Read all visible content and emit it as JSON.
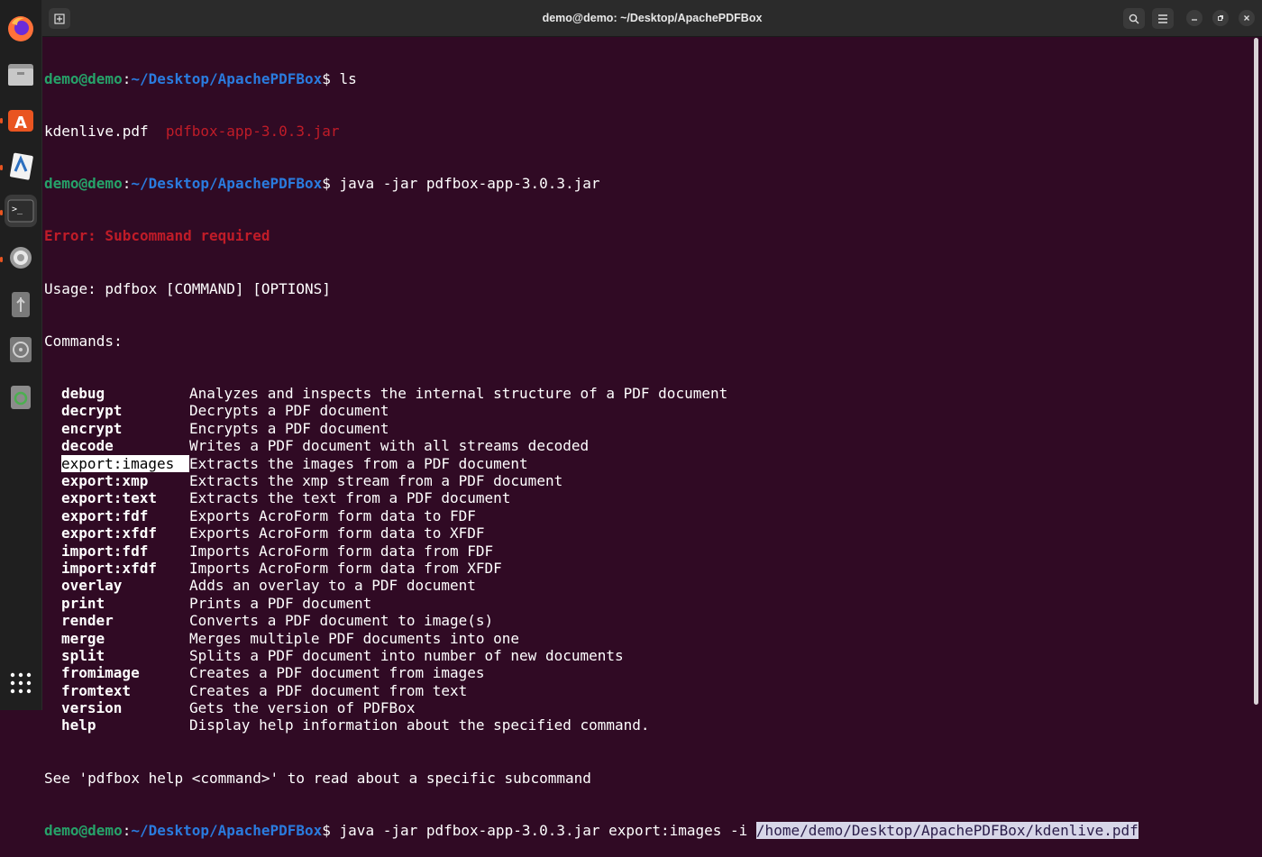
{
  "window": {
    "title": "demo@demo: ~/Desktop/ApachePDFBox"
  },
  "dock": {
    "items": [
      {
        "name": "firefox-icon"
      },
      {
        "name": "files-icon"
      },
      {
        "name": "app-center-icon"
      },
      {
        "name": "document-viewer-icon"
      },
      {
        "name": "terminal-icon"
      },
      {
        "name": "settings-icon"
      },
      {
        "name": "usb-drive-icon"
      },
      {
        "name": "disc-icon"
      },
      {
        "name": "trash-icon"
      },
      {
        "name": "show-apps-icon"
      }
    ]
  },
  "prompt": {
    "user": "demo@demo",
    "sep": ":",
    "path": "~/Desktop/ApachePDFBox",
    "dollar": "$"
  },
  "lines": {
    "cmd1": " ls",
    "ls_file1": "kdenlive.pdf",
    "ls_file2": "pdfbox-app-3.0.3.jar",
    "cmd2": " java -jar pdfbox-app-3.0.3.jar",
    "error": "Error: Subcommand required",
    "usage": "Usage: pdfbox [COMMAND] [OPTIONS]",
    "commands_header": "Commands:",
    "footer": "See 'pdfbox help <command>' to read about a specific subcommand",
    "cmd3": " java -jar pdfbox-app-3.0.3.jar export:images -i ",
    "cmd3_selected": "/home/demo/Desktop/ApachePDFBox/kdenlive.pdf"
  },
  "commands": [
    {
      "name": "debug",
      "desc": "Analyzes and inspects the internal structure of a PDF document"
    },
    {
      "name": "decrypt",
      "desc": "Decrypts a PDF document"
    },
    {
      "name": "encrypt",
      "desc": "Encrypts a PDF document"
    },
    {
      "name": "decode",
      "desc": "Writes a PDF document with all streams decoded"
    },
    {
      "name": "export:images",
      "desc": "Extracts the images from a PDF document"
    },
    {
      "name": "export:xmp",
      "desc": "Extracts the xmp stream from a PDF document"
    },
    {
      "name": "export:text",
      "desc": "Extracts the text from a PDF document"
    },
    {
      "name": "export:fdf",
      "desc": "Exports AcroForm form data to FDF"
    },
    {
      "name": "export:xfdf",
      "desc": "Exports AcroForm form data to XFDF"
    },
    {
      "name": "import:fdf",
      "desc": "Imports AcroForm form data from FDF"
    },
    {
      "name": "import:xfdf",
      "desc": "Imports AcroForm form data from XFDF"
    },
    {
      "name": "overlay",
      "desc": "Adds an overlay to a PDF document"
    },
    {
      "name": "print",
      "desc": "Prints a PDF document"
    },
    {
      "name": "render",
      "desc": "Converts a PDF document to image(s)"
    },
    {
      "name": "merge",
      "desc": "Merges multiple PDF documents into one"
    },
    {
      "name": "split",
      "desc": "Splits a PDF document into number of new documents"
    },
    {
      "name": "fromimage",
      "desc": "Creates a PDF document from images"
    },
    {
      "name": "fromtext",
      "desc": "Creates a PDF document from text"
    },
    {
      "name": "version",
      "desc": "Gets the version of PDFBox"
    },
    {
      "name": "help",
      "desc": "Display help information about the specified command."
    }
  ],
  "colors": {
    "background": "#300a24",
    "prompt_user": "#26a269",
    "prompt_path": "#2a7bde",
    "error": "#c01c28",
    "accent": "#e95420"
  }
}
